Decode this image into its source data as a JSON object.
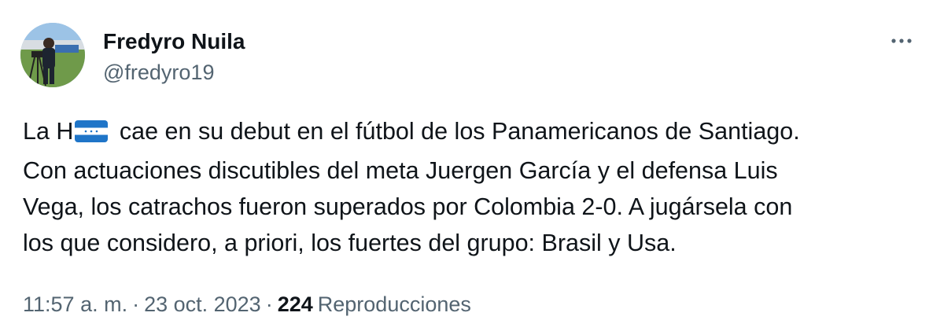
{
  "author": {
    "name": "Fredyro Nuila",
    "handle": "@fredyro19"
  },
  "more_icon": "more-horizontal-icon",
  "tweet": {
    "line1_before_flag": "La H",
    "flag_icon": "honduras-flag-icon",
    "flag_colors": {
      "blue": "#1f75c8",
      "white": "#ffffff"
    },
    "line1_after_flag": " cae en su debut en el fútbol de los Panamericanos de Santiago.",
    "line2": "Con actuaciones discutibles del meta Juergen García y el defensa Luis",
    "line3": "Vega, los catrachos fueron superados por Colombia 2-0. A jugársela con",
    "line4": "los que considero, a priori, los fuertes del grupo: Brasil y Usa."
  },
  "meta": {
    "time": "11:57 a. m.",
    "separator": "·",
    "date": "23 oct. 2023",
    "views_count": "224",
    "views_label": "Reproducciones"
  }
}
